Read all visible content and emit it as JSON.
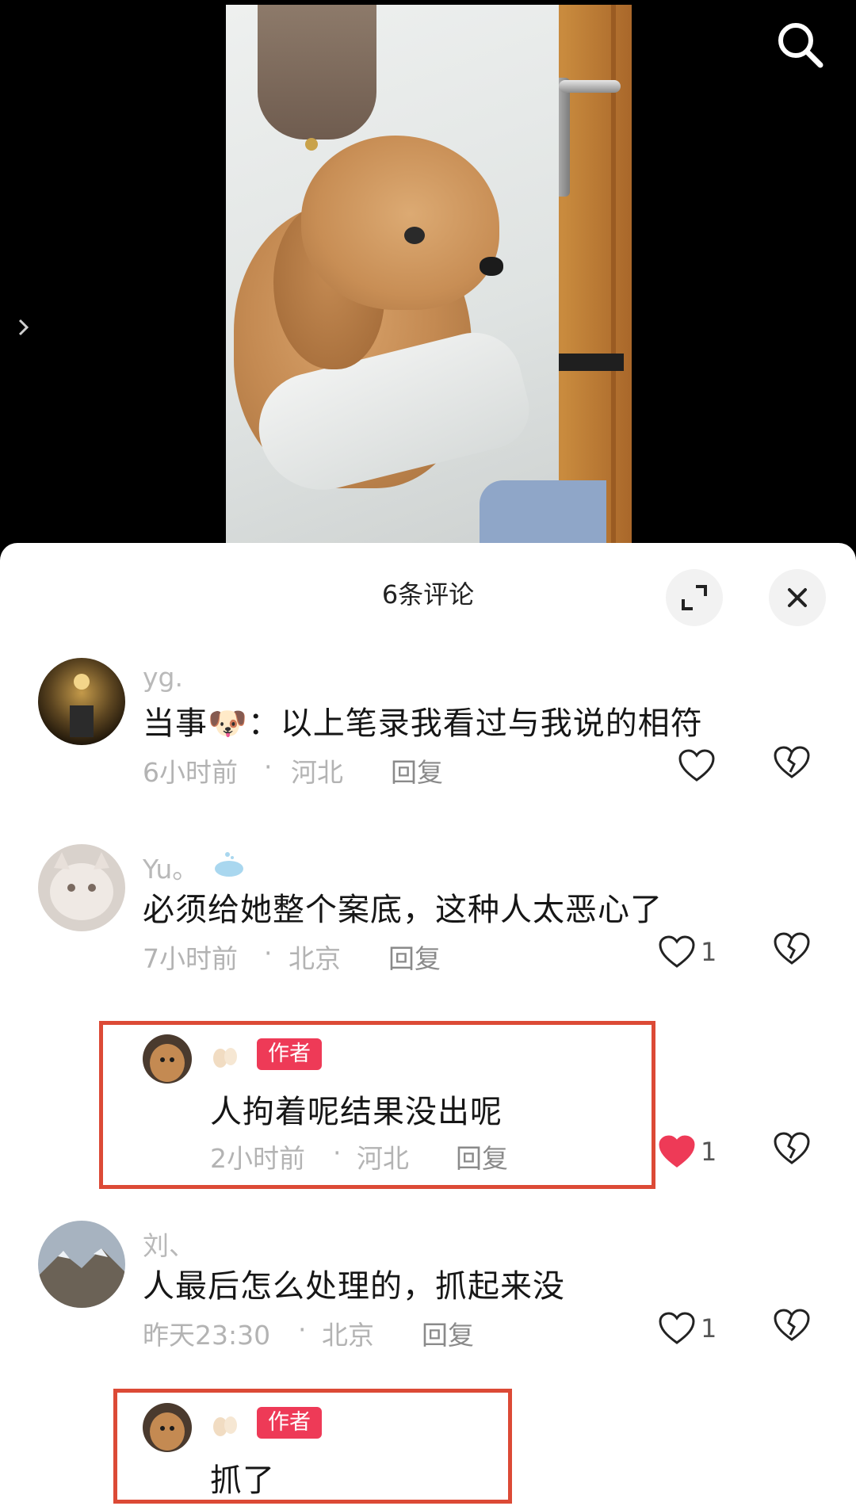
{
  "sheet": {
    "title": "6条评论"
  },
  "comments": [
    {
      "name": "yg.",
      "text": "当事🐶：以上笔录我看过与我说的相符",
      "time": "6小时前",
      "location": "河北",
      "reply_label": "回复",
      "likes": "",
      "liked": false
    },
    {
      "name": "Yu。",
      "text": "必须给她整个案底，这种人太恶心了",
      "time": "7小时前",
      "location": "北京",
      "reply_label": "回复",
      "likes": "1",
      "liked": false
    },
    {
      "name": "",
      "badge": "作者",
      "text": "人拘着呢结果没出呢",
      "time": "2小时前",
      "location": "河北",
      "reply_label": "回复",
      "likes": "1",
      "liked": true
    },
    {
      "name": "刘、",
      "text": "人最后怎么处理的，抓起来没",
      "time": "昨天23:30",
      "location": "北京",
      "reply_label": "回复",
      "likes": "1",
      "liked": false
    },
    {
      "name": "",
      "badge": "作者",
      "text": "抓了"
    }
  ],
  "separator": "·",
  "icons": {
    "search": "search-icon",
    "side_arrow": "chevron-right-icon",
    "expand": "expand-icon",
    "close": "close-icon",
    "like": "heart-icon",
    "dislike": "broken-heart-icon"
  },
  "colors": {
    "liked_heart": "#ee3a57",
    "author_badge": "#ee3a57",
    "highlight_box": "#dc4a36"
  }
}
